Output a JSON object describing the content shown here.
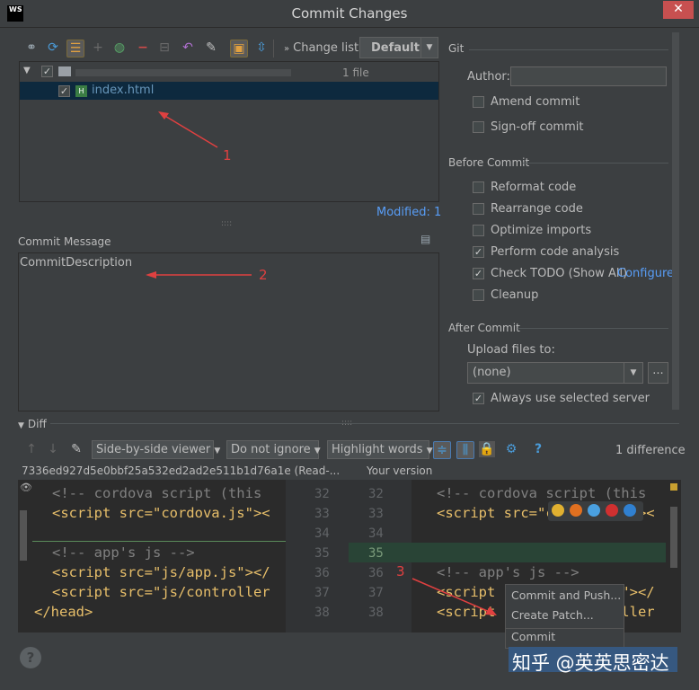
{
  "window": {
    "title": "Commit Changes",
    "close": "✕",
    "app_icon": "WS"
  },
  "toolbar": {
    "changelist_label": "Change list:",
    "changelist_value": "Default",
    "icons": [
      "diff-icon",
      "refresh-icon",
      "group-icon",
      "add-icon",
      "move-icon",
      "remove-icon",
      "collapse-icon",
      "revert-icon",
      "edit-source-icon",
      "show-diff-icon",
      "expand-icon"
    ]
  },
  "tree": {
    "root_count": "1 file",
    "file": "index.html",
    "modified": "Modified: 1"
  },
  "commit_message": {
    "label": "Commit Message",
    "text": "CommitDescription"
  },
  "git": {
    "section": "Git",
    "author_label": "Author:",
    "amend": "Amend commit",
    "signoff": "Sign-off commit"
  },
  "before_commit": {
    "section": "Before Commit",
    "options": [
      {
        "label": "Reformat code",
        "checked": false
      },
      {
        "label": "Rearrange code",
        "checked": false
      },
      {
        "label": "Optimize imports",
        "checked": false
      },
      {
        "label": "Perform code analysis",
        "checked": true
      },
      {
        "label": "Check TODO (Show All)",
        "checked": true
      },
      {
        "label": "Cleanup",
        "checked": false
      }
    ],
    "configure": "Configure"
  },
  "after_commit": {
    "section": "After Commit",
    "upload_label": "Upload files to:",
    "upload_value": "(none)",
    "upload_more": "...",
    "always_use": "Always use selected server"
  },
  "diff": {
    "label": "Diff",
    "viewer": "Side-by-side viewer",
    "ignore": "Do not ignore",
    "highlight": "Highlight words",
    "differences": "1 difference",
    "left_header": "7336ed927d5e0bbf25a532ed2ad2e511b1d76a1e (Read-...",
    "right_header": "Your version",
    "left_lines": [
      "32",
      "33",
      "34",
      "35",
      "36",
      "37",
      "38"
    ],
    "right_lines": [
      "32",
      "33",
      "34",
      "35",
      "36",
      "37",
      "38"
    ],
    "left_code": [
      "<!-- cordova script (this",
      "<script src=\"cordova.js\"><",
      "",
      "<!-- app's js -->",
      "<script src=\"js/app.js\"></",
      "<script src=\"js/controller",
      "</head>"
    ],
    "right_code": [
      "<!-- cordova script (this",
      "<script src=\"cordova.js\"><",
      "",
      "",
      "<!-- app's js -->",
      "<script src=\"js/app.js\"></",
      "<script src=\"js/controller"
    ]
  },
  "popup": {
    "items": [
      "Commit and Push...",
      "Create Patch...",
      "Commit"
    ]
  },
  "annotations": {
    "a1": "1",
    "a2": "2",
    "a3": "3"
  },
  "watermark": "知乎 @英英思密达",
  "help": "?"
}
